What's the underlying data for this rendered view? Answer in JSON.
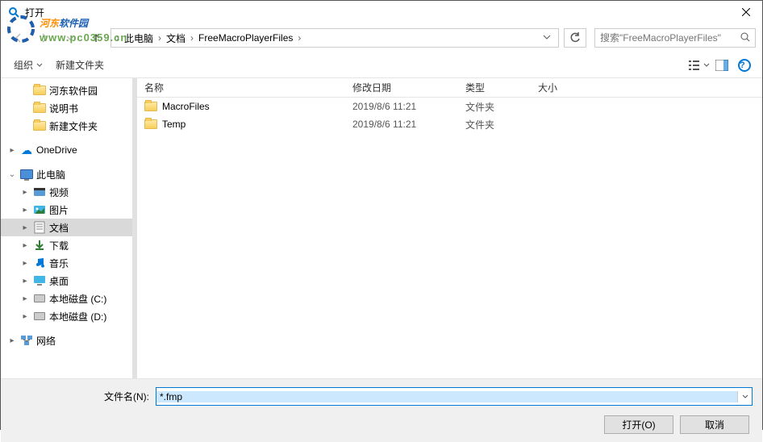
{
  "window": {
    "title": "打开"
  },
  "watermark": {
    "name1": "河东",
    "name2": "软件园",
    "url": "www.pc0359.cn"
  },
  "nav": {
    "breadcrumbs": [
      "此电脑",
      "文档",
      "FreeMacroPlayerFiles"
    ],
    "search_placeholder": "搜索\"FreeMacroPlayerFiles\""
  },
  "toolbar": {
    "organize": "组织",
    "newfolder": "新建文件夹"
  },
  "tree": {
    "items": [
      {
        "label": "河东软件园",
        "level": 2,
        "icon": "folder",
        "chev": ""
      },
      {
        "label": "说明书",
        "level": 2,
        "icon": "folder",
        "chev": ""
      },
      {
        "label": "新建文件夹",
        "level": 2,
        "icon": "folder",
        "chev": ""
      },
      {
        "_spacer": true
      },
      {
        "label": "OneDrive",
        "level": 1,
        "icon": "cloud",
        "chev": "▸"
      },
      {
        "_spacer": true
      },
      {
        "label": "此电脑",
        "level": 1,
        "icon": "pc",
        "chev": "⌄"
      },
      {
        "label": "视频",
        "level": 2,
        "icon": "video",
        "chev": "▸"
      },
      {
        "label": "图片",
        "level": 2,
        "icon": "pic",
        "chev": "▸"
      },
      {
        "label": "文档",
        "level": 2,
        "icon": "doc",
        "chev": "▸",
        "selected": true
      },
      {
        "label": "下载",
        "level": 2,
        "icon": "download",
        "chev": "▸"
      },
      {
        "label": "音乐",
        "level": 2,
        "icon": "music",
        "chev": "▸"
      },
      {
        "label": "桌面",
        "level": 2,
        "icon": "desktop",
        "chev": "▸"
      },
      {
        "label": "本地磁盘 (C:)",
        "level": 2,
        "icon": "disk",
        "chev": "▸"
      },
      {
        "label": "本地磁盘 (D:)",
        "level": 2,
        "icon": "disk",
        "chev": "▸"
      },
      {
        "_spacer": true
      },
      {
        "label": "网络",
        "level": 1,
        "icon": "network",
        "chev": "▸"
      }
    ]
  },
  "columns": {
    "name": "名称",
    "date": "修改日期",
    "type": "类型",
    "size": "大小"
  },
  "files": [
    {
      "name": "MacroFiles",
      "date": "2019/8/6 11:21",
      "type": "文件夹"
    },
    {
      "name": "Temp",
      "date": "2019/8/6 11:21",
      "type": "文件夹"
    }
  ],
  "bottom": {
    "filename_label": "文件名(N):",
    "filename_value": "*.fmp",
    "open": "打开(O)",
    "cancel": "取消"
  }
}
